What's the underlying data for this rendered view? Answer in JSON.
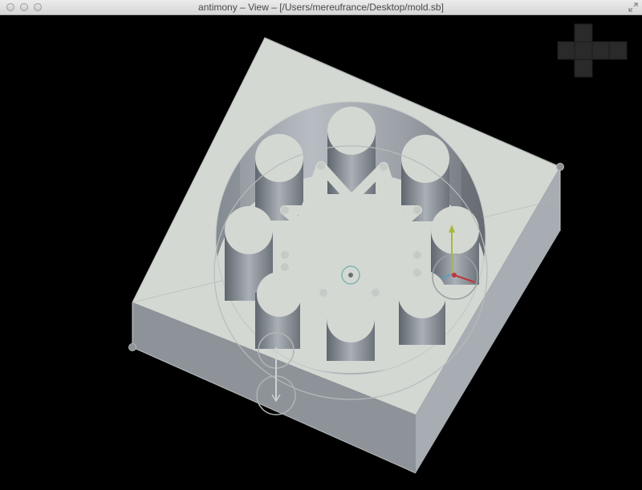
{
  "window": {
    "title": "antimony – View – [/Users/mereufrance/Desktop/mold.sb]"
  },
  "icons": {
    "close": "close-button-icon",
    "minimize": "minimize-button-icon",
    "zoom": "zoom-button-icon",
    "fullscreen": "fullscreen-arrows-icon",
    "view_cube": "view-cube-icon"
  },
  "colors": {
    "background": "#000000",
    "top_face": "#d4d8d3",
    "front_face": "#8d9399",
    "right_face": "#a7adb3",
    "handle": "#c8ccc8",
    "axis_x": "#c0353a",
    "axis_y": "#a8b83a",
    "axis_z": "#5aa0c0"
  }
}
